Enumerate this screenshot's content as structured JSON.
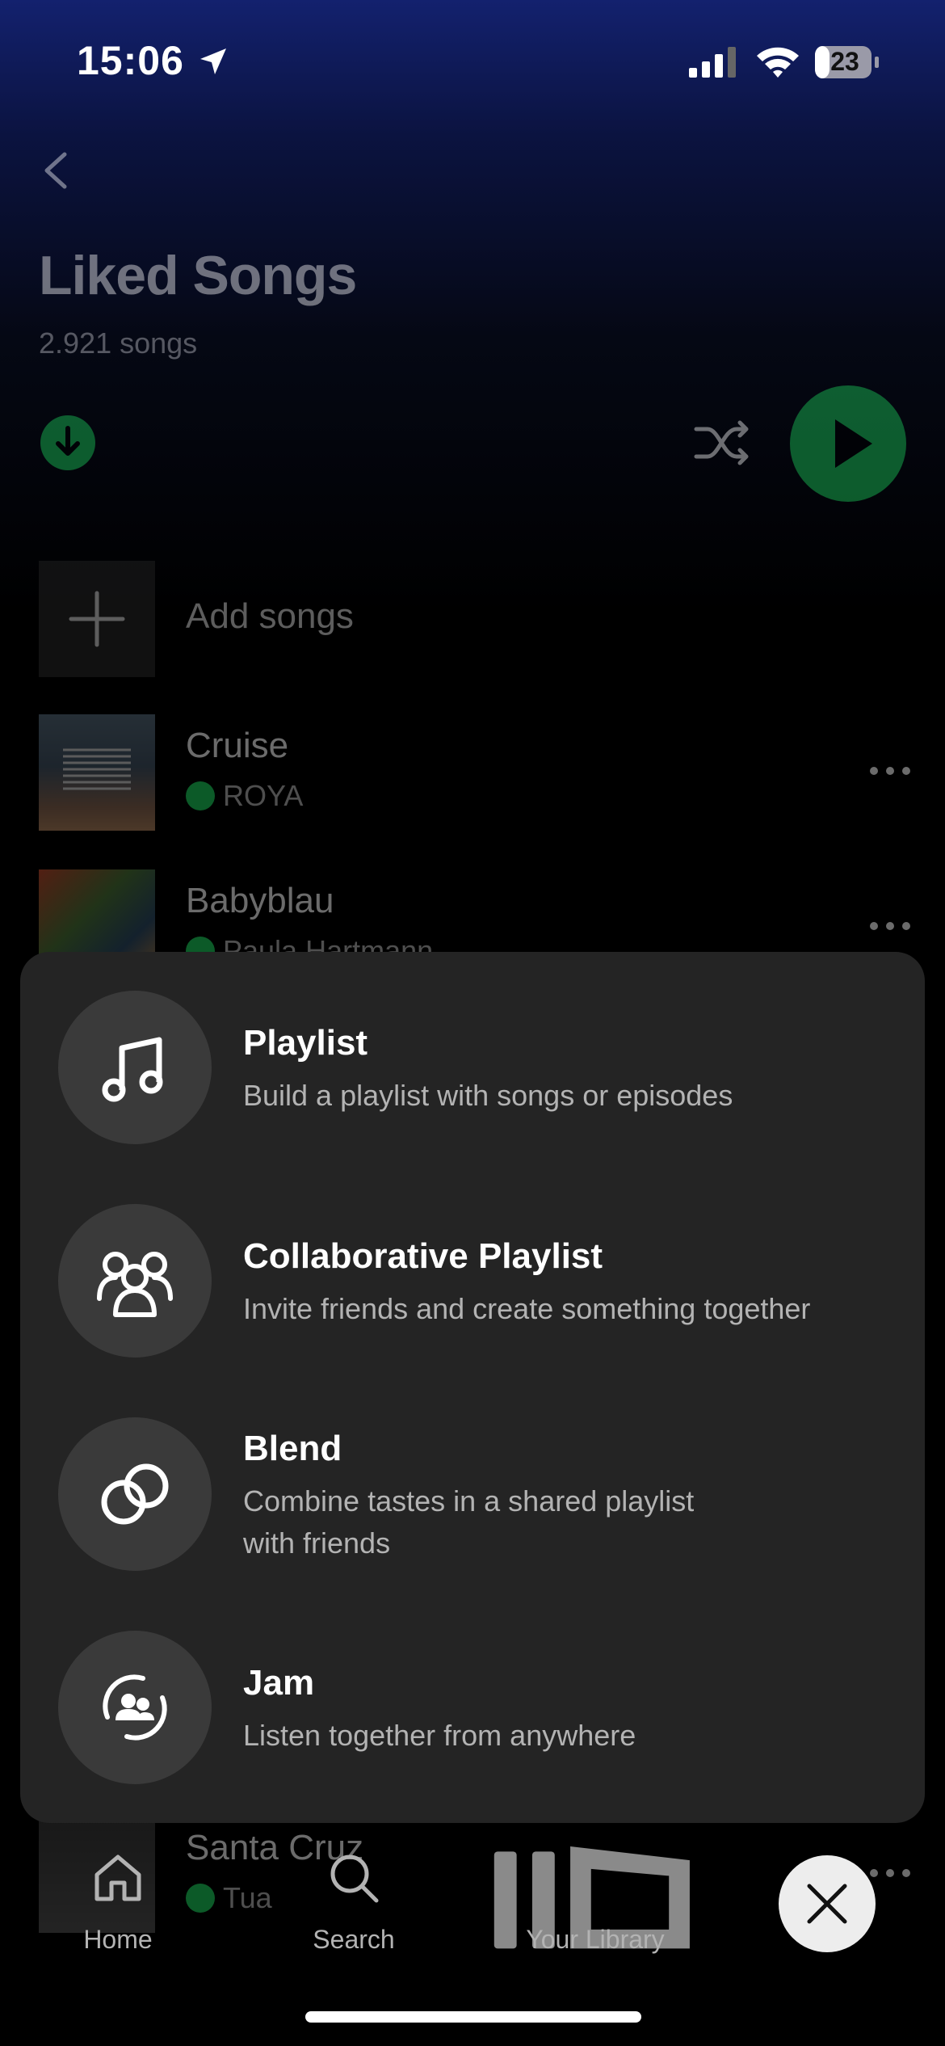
{
  "status_bar": {
    "time": "15:06",
    "battery": "23",
    "icons": [
      "location-arrow-icon",
      "signal-icon",
      "wifi-icon",
      "battery-icon"
    ]
  },
  "header": {
    "title": "Liked Songs",
    "song_count": "2.921 songs",
    "icons": [
      "back-chevron-icon",
      "download-icon",
      "shuffle-icon",
      "play-icon"
    ]
  },
  "tracks": [
    {
      "title": "Add songs",
      "icon": "plus-icon"
    },
    {
      "title": "Cruise",
      "artist": "ROYA",
      "downloaded": true
    },
    {
      "title": "Babyblau",
      "artist": "Paula Hartmann",
      "downloaded": true
    },
    {
      "title": "Santa Cruz",
      "artist": "Tua",
      "downloaded": true
    }
  ],
  "create_sheet": {
    "options": [
      {
        "title": "Playlist",
        "description": "Build a playlist with songs or episodes",
        "icon": "music-note-icon"
      },
      {
        "title": "Collaborative Playlist",
        "description": "Invite friends and create something together",
        "icon": "collaborators-icon"
      },
      {
        "title": "Blend",
        "description_line1": "Combine tastes in a shared playlist",
        "description_line2": "with friends",
        "icon": "blend-icon"
      },
      {
        "title": "Jam",
        "description": "Listen together from anywhere",
        "icon": "jam-icon"
      }
    ]
  },
  "tab_bar": {
    "tabs": [
      {
        "label": "Home",
        "icon": "home-icon"
      },
      {
        "label": "Search",
        "icon": "search-icon"
      },
      {
        "label": "Your Library",
        "icon": "library-icon"
      }
    ],
    "close_icon": "close-icon"
  },
  "colors": {
    "accent": "#1ed760",
    "sheet_background": "#242424",
    "option_circle": "#3a3a3a",
    "header_gradient_top": "#13216e"
  }
}
